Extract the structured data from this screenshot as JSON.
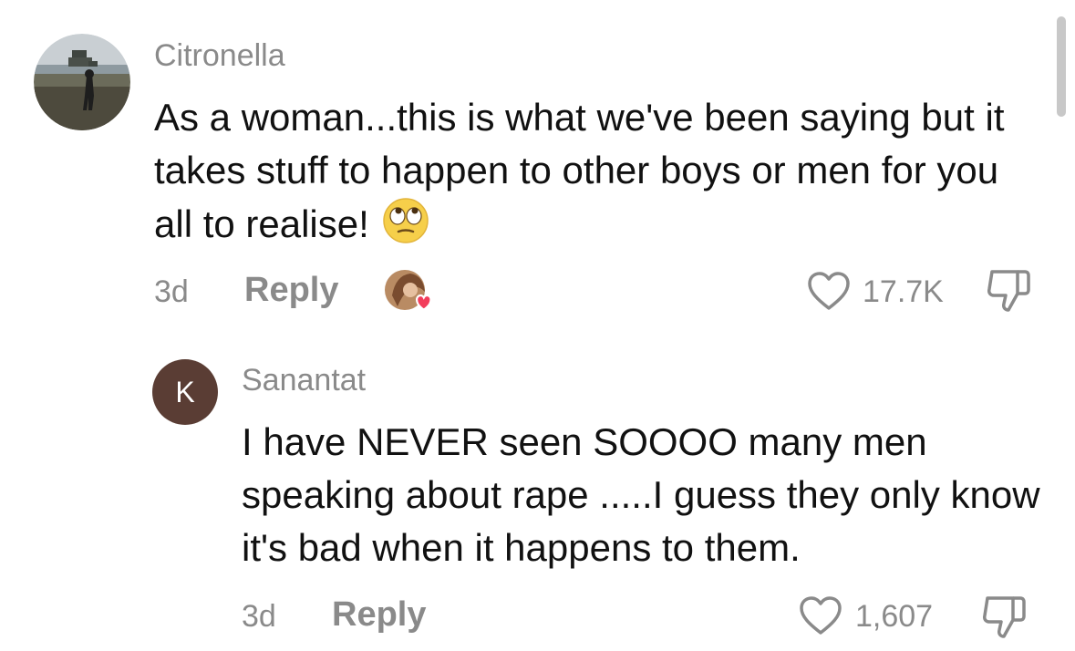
{
  "comments": [
    {
      "username": "Citronella",
      "text": "As a woman...this is what we've been saying but it takes stuff to happen to other boys or men for you all to realise!",
      "emoji": "eye-roll-emoji",
      "time": "3d",
      "reply_label": "Reply",
      "likes": "17.7K"
    },
    {
      "username": "Sanantat",
      "avatar_letter": "K",
      "text": "I have NEVER seen SOOOO many men speaking about rape .....I guess they only know it's bad when it happens to them.",
      "time": "3d",
      "reply_label": "Reply",
      "likes": "1,607"
    }
  ],
  "colors": {
    "meta_gray": "#8a8a8a",
    "avatar_brown": "#5a3d34",
    "heart_red": "#f23d5b"
  }
}
